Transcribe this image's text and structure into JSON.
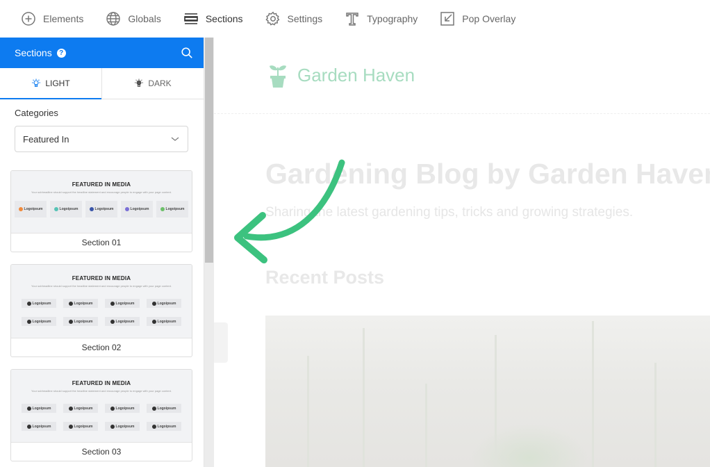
{
  "toolbar": {
    "items": [
      {
        "label": "Elements",
        "icon": "plus-circle-icon"
      },
      {
        "label": "Globals",
        "icon": "globe-icon"
      },
      {
        "label": "Sections",
        "icon": "sections-icon"
      },
      {
        "label": "Settings",
        "icon": "gear-icon"
      },
      {
        "label": "Typography",
        "icon": "typography-icon"
      },
      {
        "label": "Pop Overlay",
        "icon": "pop-overlay-icon"
      }
    ],
    "active": "Sections"
  },
  "sidebar": {
    "title": "Sections",
    "help": "?",
    "tabs": [
      {
        "label": "LIGHT",
        "icon": "light-bulb-icon"
      },
      {
        "label": "DARK",
        "icon": "dark-bulb-icon"
      }
    ],
    "active_tab": "LIGHT",
    "categories_label": "Categories",
    "category_value": "Featured In",
    "sections": [
      {
        "name": "Section 01",
        "thumb_title": "FEATURED IN MEDIA",
        "thumb_sub": "Your subheadline should support the headline statement and encourage people to engage with your page content.",
        "logos": [
          "Logoipsum",
          "Logoipsum",
          "Logoipsum",
          "Logoipsum",
          "Logoipsum"
        ]
      },
      {
        "name": "Section 02",
        "thumb_title": "FEATURED IN MEDIA",
        "thumb_sub": "Your subheadline should support the headline statement and encourage people to engage with your page content.",
        "logos": [
          "Logoipsum",
          "Logoipsum",
          "Logoipsum",
          "Logoipsum",
          "Logoipsum",
          "Logoipsum",
          "Logoipsum",
          "Logoipsum"
        ]
      },
      {
        "name": "Section 03",
        "thumb_title": "FEATURED IN MEDIA",
        "thumb_sub": "Your subheadline should support the headline statement and encourage people to engage with your page content.",
        "logos": [
          "Logoipsum",
          "Logoipsum",
          "Logoipsum",
          "Logoipsum",
          "Logoipsum",
          "Logoipsum",
          "Logoipsum",
          "Logoipsum"
        ]
      }
    ]
  },
  "canvas": {
    "brand": "Garden Haven",
    "hero_title": "Gardening Blog by Garden Haven",
    "hero_sub": "Sharing the latest gardening tips, tricks and growing strategies.",
    "recent_heading": "Recent Posts"
  },
  "colors": {
    "accent": "#0d7bf0",
    "arrow": "#3cc27f",
    "brand": "#a7dcc0"
  }
}
